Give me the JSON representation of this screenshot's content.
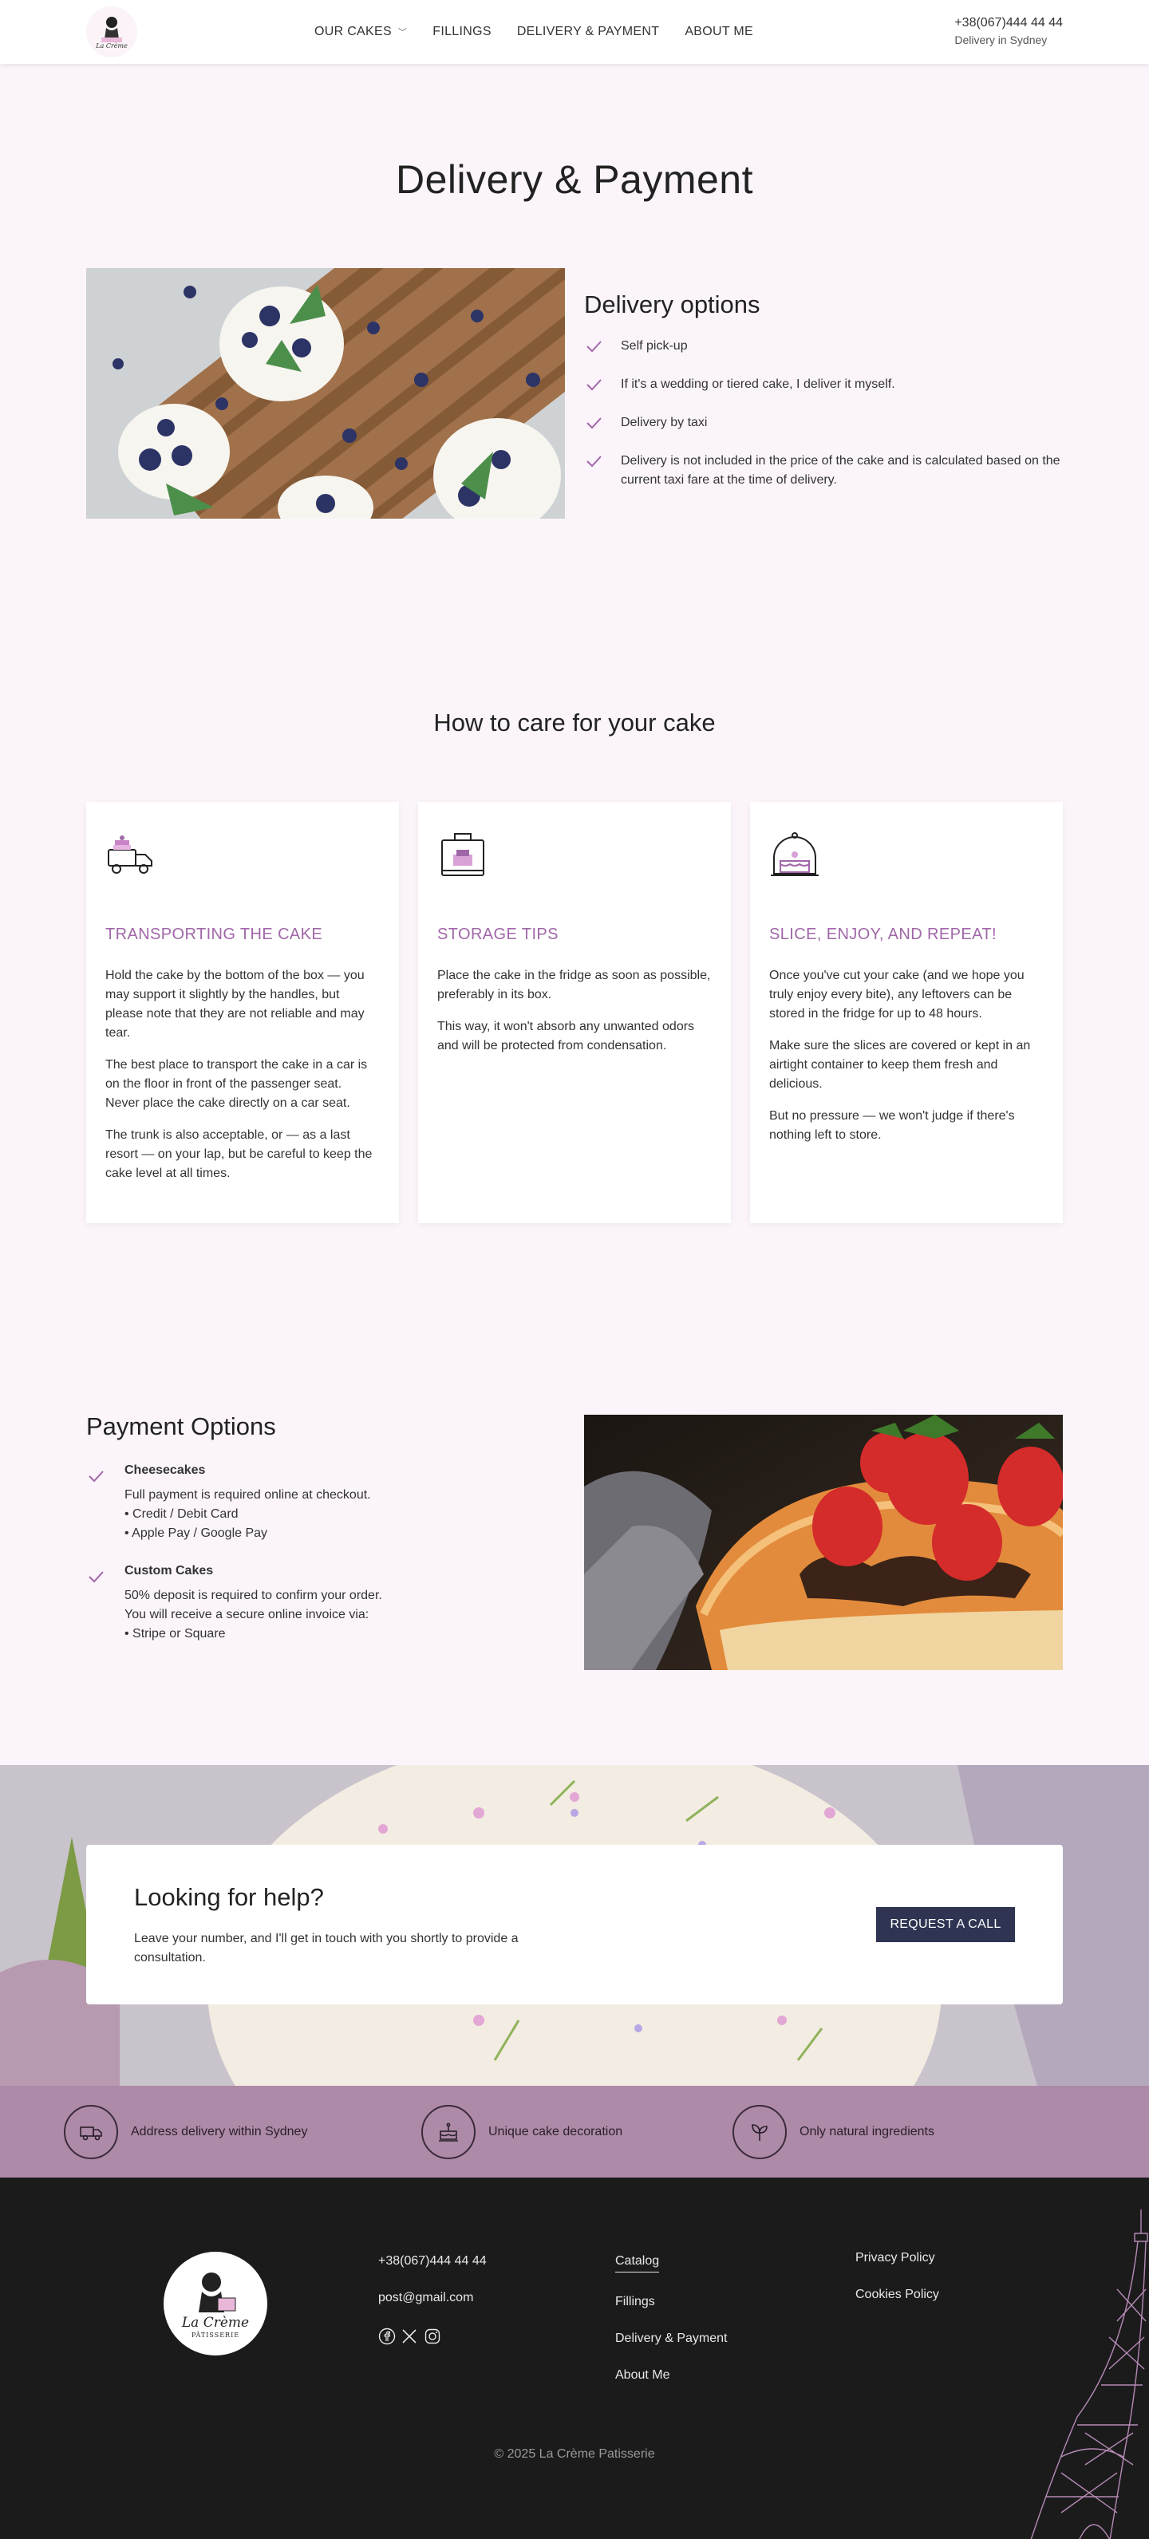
{
  "header": {
    "logo_text": "La Crème",
    "nav": [
      {
        "label": "OUR CAKES",
        "has_dropdown": true
      },
      {
        "label": "FILLINGS"
      },
      {
        "label": "DELIVERY & PAYMENT"
      },
      {
        "label": "ABOUT ME"
      }
    ],
    "phone": "+38(067)444 44 44",
    "city": "Delivery in Sydney"
  },
  "page_title": "Delivery & Payment",
  "delivery": {
    "title": "Delivery options",
    "items": [
      "Self pick-up",
      "If it's a wedding or tiered cake, I deliver it myself.",
      "Delivery by taxi",
      "Delivery is not included in the price of the cake and is calculated based on the current taxi fare at the time of delivery."
    ]
  },
  "care": {
    "title": "How to care for your cake",
    "cards": [
      {
        "icon": "cake-truck-icon",
        "title": "TRANSPORTING THE CAKE",
        "paragraphs": [
          "Hold the cake by the bottom of the box — you may support it slightly by the handles, but please note that they are not reliable and may tear.",
          "The best place to transport the cake in a car is on the floor in front of the passenger seat.",
          "Never place the cake directly on a car seat.",
          "The trunk is also acceptable, or — as a last resort — on your lap, but be careful to keep the cake level at all times."
        ]
      },
      {
        "icon": "cake-box-icon",
        "title": "STORAGE TIPS",
        "paragraphs": [
          "Place the cake in the fridge as soon as possible, preferably in its box.",
          "This way, it won't absorb any unwanted odors and will be protected from condensation."
        ]
      },
      {
        "icon": "cake-dome-icon",
        "title": "SLICE, ENJOY, AND REPEAT!",
        "paragraphs": [
          "Once you've cut your cake (and we hope you truly enjoy every bite), any leftovers can be stored in the fridge for up to 48 hours.",
          "Make sure the slices are covered or kept in an airtight container to keep them fresh and delicious.",
          "But no pressure — we won't judge if there's nothing left to store."
        ]
      }
    ]
  },
  "payment": {
    "title": "Payment Options",
    "items": [
      {
        "name": "Cheesecakes",
        "lines": [
          "Full payment is required online at checkout.",
          "• Credit / Debit Card",
          "• Apple Pay / Google Pay"
        ]
      },
      {
        "name": "Custom Cakes",
        "lines": [
          "50% deposit is required to confirm your order.",
          "You will receive a secure online invoice via:",
          "• Stripe or Square"
        ]
      }
    ]
  },
  "help": {
    "title": "Looking for help?",
    "text": "Leave your number, and I'll get in touch with you shortly to provide a consultation.",
    "button": "REQUEST A CALL"
  },
  "features": [
    {
      "icon": "delivery-truck-icon",
      "label": "Address delivery within Sydney"
    },
    {
      "icon": "cake-decoration-icon",
      "label": "Unique cake decoration"
    },
    {
      "icon": "leaf-icon",
      "label": "Only natural ingredients"
    }
  ],
  "footer": {
    "logo_text": "La Crème",
    "logo_sub": "PÂTISSERIE",
    "phone": "+38(067)444 44 44",
    "email": "post@gmail.com",
    "social": [
      "facebook-icon",
      "x-icon",
      "instagram-icon"
    ],
    "links": [
      "Catalog",
      "Fillings",
      "Delivery & Payment",
      "About Me"
    ],
    "legal": [
      "Privacy Policy",
      "Cookies Policy"
    ],
    "copyright": "© 2025 La Crème Patisserie"
  },
  "colors": {
    "accent": "#a067a8",
    "button": "#2e3452",
    "feature_band": "#ad8aa8",
    "footer": "#1c1b1c",
    "page_bg": "#fbf5fb"
  }
}
